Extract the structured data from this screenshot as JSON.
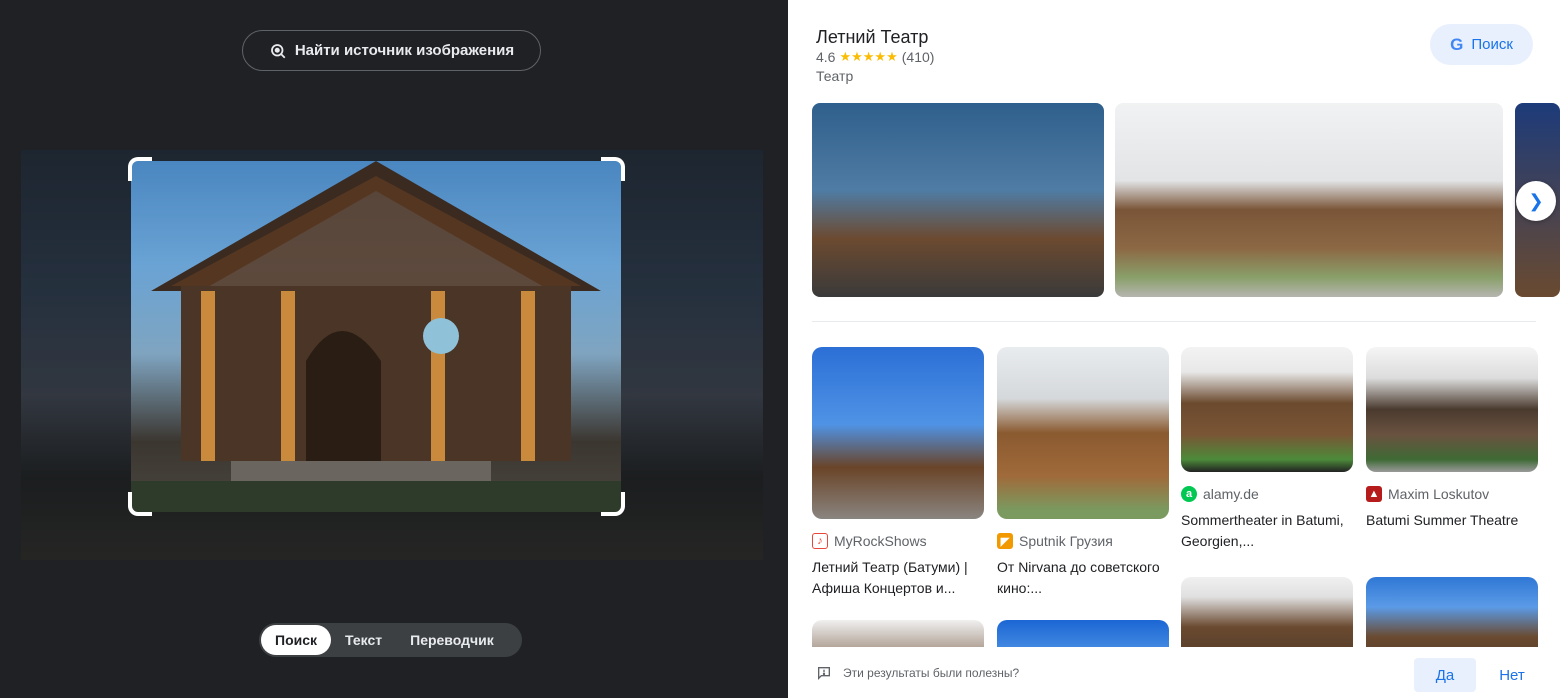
{
  "lens": {
    "find_source_label": "Найти источник изображения",
    "modes": [
      "Поиск",
      "Текст",
      "Переводчик"
    ],
    "active_mode": "Поиск"
  },
  "place": {
    "title": "Летний Театр",
    "rating": "4.6",
    "stars": "★★★★★",
    "reviews": "(410)",
    "category": "Театр",
    "search_label": "Поиск"
  },
  "results": [
    {
      "source": "MyRockShows",
      "title": "Летний Театр (Батуми) | Афиша Концертов и...",
      "icon_color": "#e8453c"
    },
    {
      "source": "Sputnik Грузия",
      "title": "От Nirvana до советского кино:...",
      "icon_color": "#f29900"
    },
    {
      "source": "alamy.de",
      "title": "Sommertheater in Batumi, Georgien,...",
      "icon_color": "#00c853"
    },
    {
      "source": "Maxim Loskutov",
      "title": "Batumi Summer Theatre",
      "icon_color": "#c62828"
    }
  ],
  "feedback": {
    "question": "Эти результаты были полезны?",
    "yes": "Да",
    "no": "Нет"
  },
  "colors": {
    "accent": "#1a73e8",
    "dark_bg": "#202124",
    "star": "#fbbc04"
  }
}
